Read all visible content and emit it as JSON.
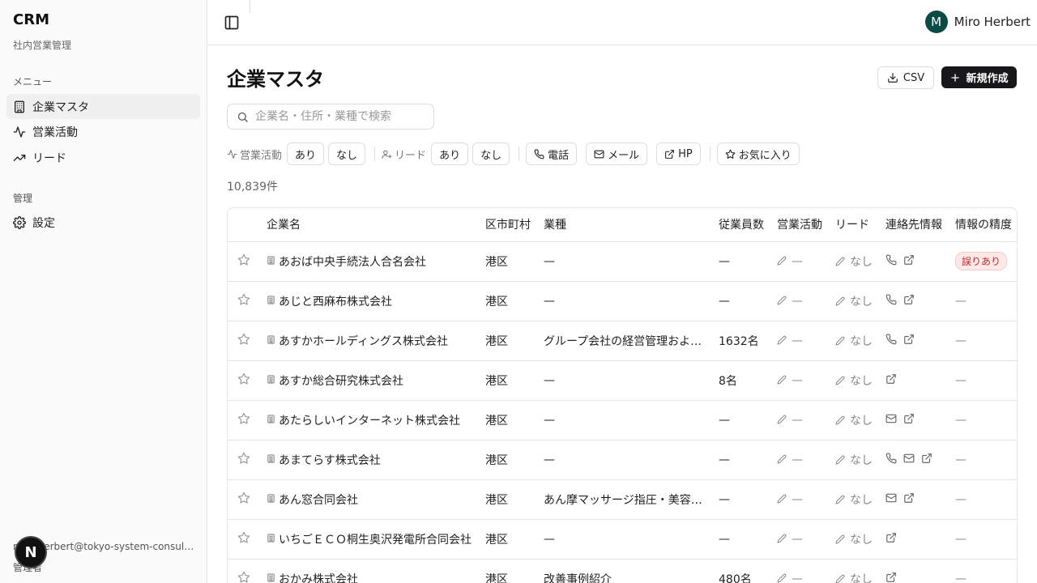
{
  "sidebar": {
    "brand": "CRM",
    "brand_sub": "社内営業管理",
    "menu_label": "メニュー",
    "menu_items": [
      {
        "label": "企業マスタ",
        "icon": "building-icon",
        "active": true
      },
      {
        "label": "営業活動",
        "icon": "activity-icon",
        "active": false
      },
      {
        "label": "リード",
        "icon": "trending-up-icon",
        "active": false
      }
    ],
    "admin_label": "管理",
    "admin_items": [
      {
        "label": "設定",
        "icon": "gear-icon"
      }
    ],
    "user_email": "miro.herbert@tokyo-system-consulting.co.jp",
    "user_role": "管理者",
    "n_badge": "N"
  },
  "header": {
    "avatar_initial": "M",
    "user_name": "Miro Herbert"
  },
  "page": {
    "title": "企業マスタ",
    "csv_label": "CSV",
    "new_label": "新規作成",
    "search_placeholder": "企業名・住所・業種で検索",
    "count": "10,839件"
  },
  "filters": {
    "activity_label": "営業活動",
    "lead_label": "リード",
    "yes": "あり",
    "no": "なし",
    "phone": "電話",
    "mail": "メール",
    "hp": "HP",
    "favorite": "お気に入り"
  },
  "table": {
    "headers": {
      "name": "企業名",
      "city": "区市町村",
      "industry": "業種",
      "employees": "従業員数",
      "activity": "営業活動",
      "lead": "リード",
      "contact": "連絡先情報",
      "accuracy": "情報の精度"
    },
    "rows": [
      {
        "name": "あおば中央手続法人合名会社",
        "city": "港区",
        "industry": "—",
        "employees": "—",
        "activity": "—",
        "lead": "なし",
        "contacts": [
          "phone",
          "external"
        ],
        "accuracy": "誤りあり"
      },
      {
        "name": "あじと西麻布株式会社",
        "city": "港区",
        "industry": "—",
        "employees": "—",
        "activity": "—",
        "lead": "なし",
        "contacts": [
          "phone",
          "external"
        ],
        "accuracy": "—"
      },
      {
        "name": "あすかホールディングス株式会社",
        "city": "港区",
        "industry": "グループ会社の経営管理および関連業務",
        "employees": "1632名",
        "activity": "—",
        "lead": "なし",
        "contacts": [
          "phone",
          "external"
        ],
        "accuracy": "—"
      },
      {
        "name": "あすか総合研究株式会社",
        "city": "港区",
        "industry": "—",
        "employees": "8名",
        "activity": "—",
        "lead": "なし",
        "contacts": [
          "external"
        ],
        "accuracy": "—"
      },
      {
        "name": "あたらしいインターネット株式会社",
        "city": "港区",
        "industry": "—",
        "employees": "—",
        "activity": "—",
        "lead": "なし",
        "contacts": [
          "mail",
          "external"
        ],
        "accuracy": "—"
      },
      {
        "name": "あまてらす株式会社",
        "city": "港区",
        "industry": "—",
        "employees": "—",
        "activity": "—",
        "lead": "なし",
        "contacts": [
          "phone",
          "mail",
          "external"
        ],
        "accuracy": "—"
      },
      {
        "name": "あん窓合同会社",
        "city": "港区",
        "industry": "あん摩マッサージ指圧・美容関連",
        "employees": "—",
        "activity": "—",
        "lead": "なし",
        "contacts": [
          "mail",
          "external"
        ],
        "accuracy": "—"
      },
      {
        "name": "いちごＥＣＯ桐生奥沢発電所合同会社",
        "city": "港区",
        "industry": "—",
        "employees": "—",
        "activity": "—",
        "lead": "なし",
        "contacts": [
          "external"
        ],
        "accuracy": "—"
      },
      {
        "name": "おかみ株式会社",
        "city": "港区",
        "industry": "改善事例紹介",
        "employees": "480名",
        "activity": "—",
        "lead": "なし",
        "contacts": [
          "external"
        ],
        "accuracy": "—"
      }
    ]
  },
  "colors": {
    "accent_dark": "#18181b",
    "avatar_bg": "#0b4a45",
    "error_badge_bg": "#fde8e8",
    "error_badge_fg": "#c62828"
  }
}
